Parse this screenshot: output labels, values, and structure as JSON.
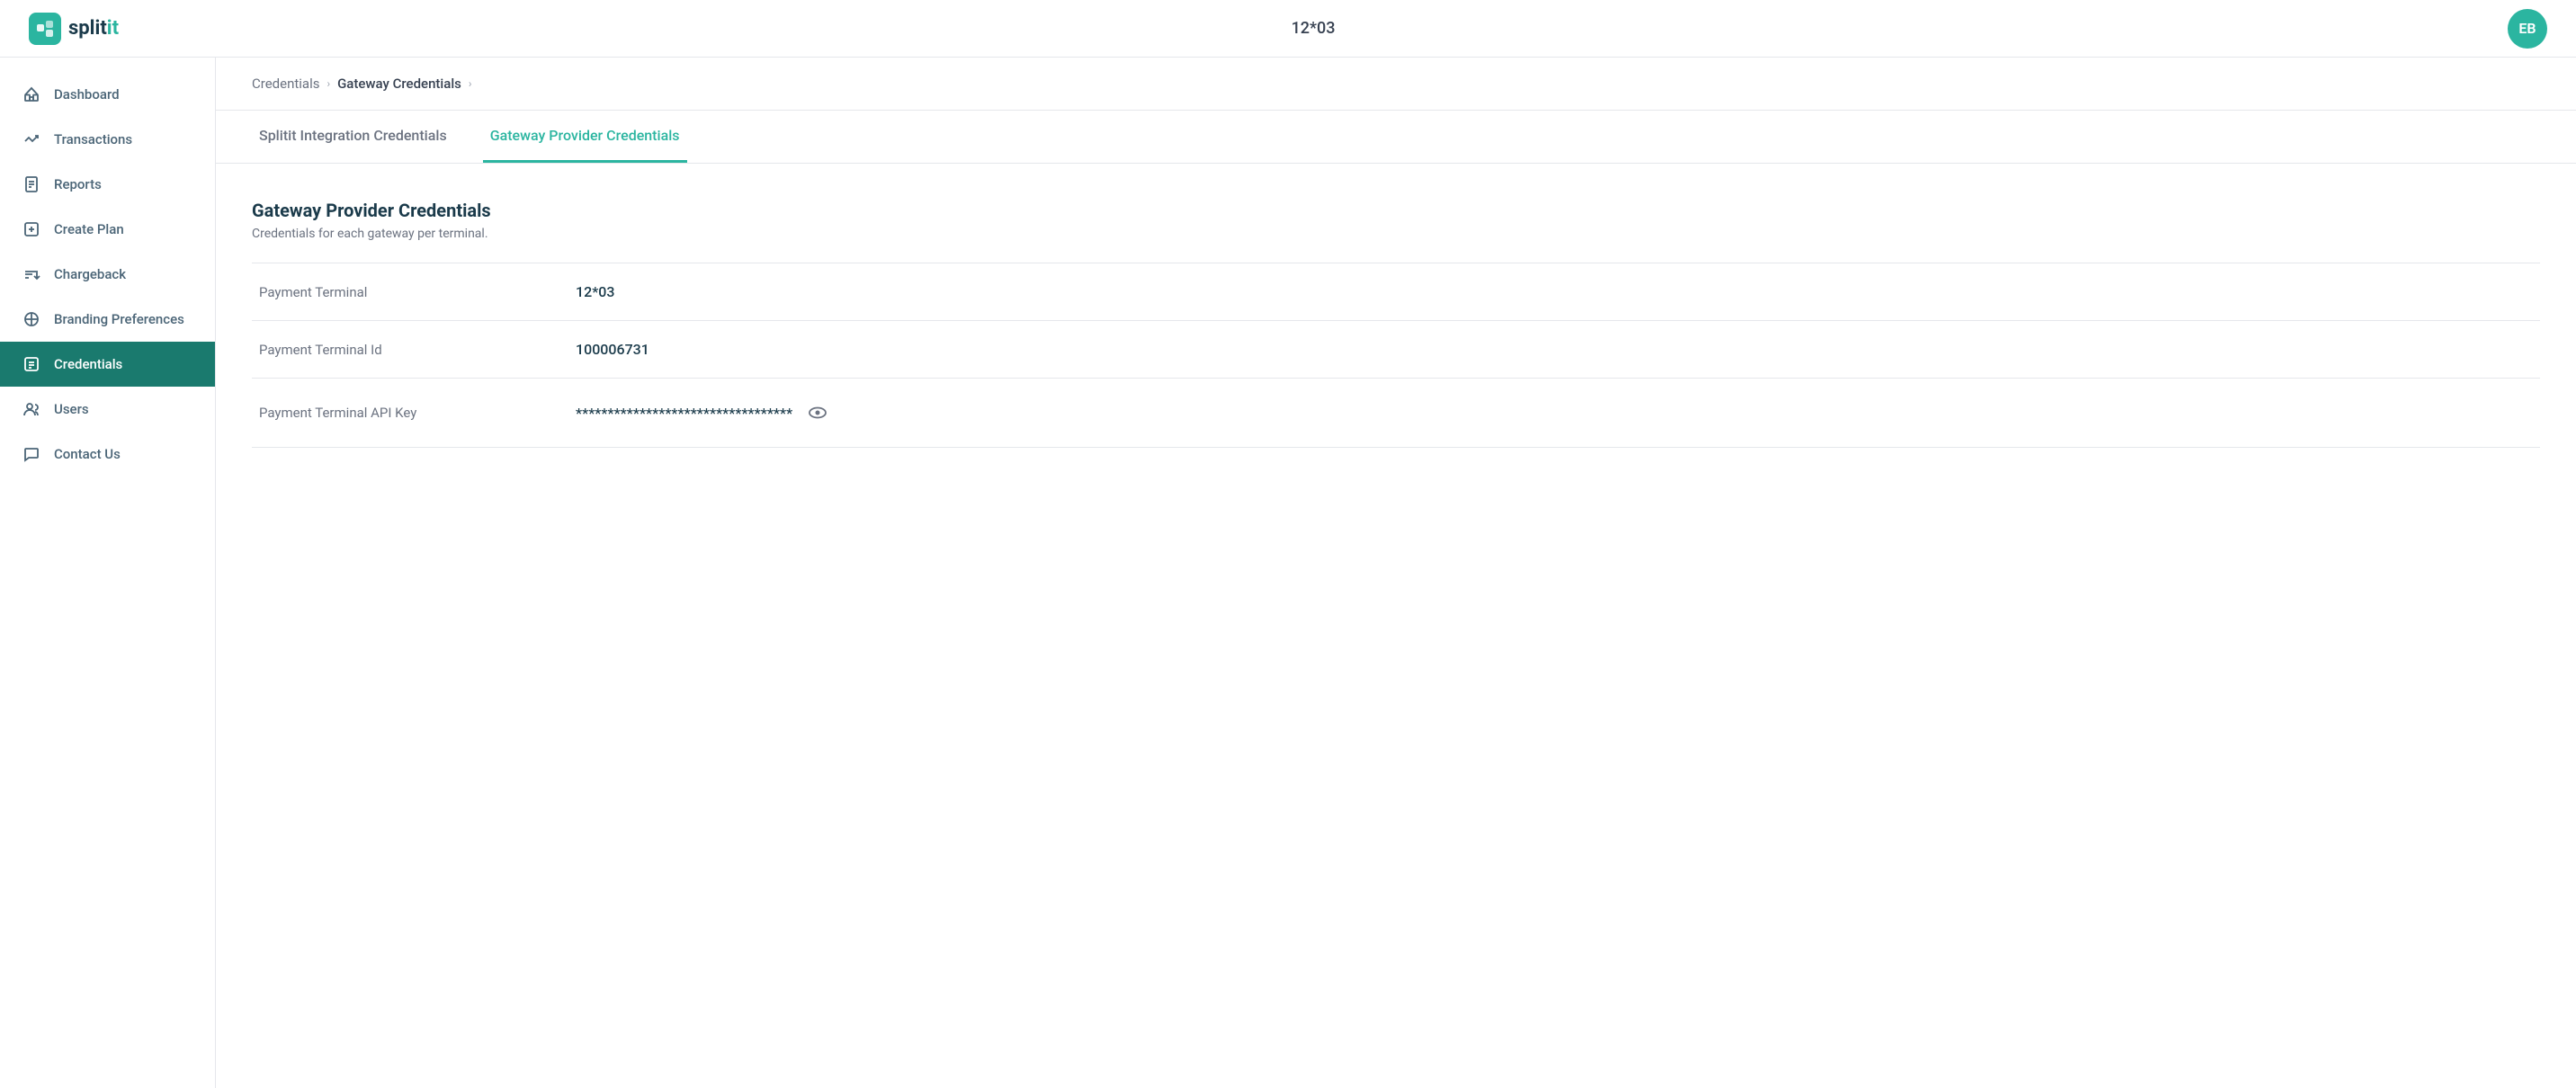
{
  "header": {
    "title": "12*03",
    "avatar_initials": "EB",
    "logo_text": "splitit"
  },
  "breadcrumb": {
    "items": [
      {
        "label": "Credentials",
        "active": false
      },
      {
        "label": "Gateway Credentials",
        "active": true
      }
    ]
  },
  "tabs": [
    {
      "label": "Splitit Integration Credentials",
      "active": false
    },
    {
      "label": "Gateway Provider Credentials",
      "active": true
    }
  ],
  "section": {
    "title": "Gateway Provider Credentials",
    "subtitle": "Credentials for each gateway per terminal."
  },
  "credentials": [
    {
      "label": "Payment Terminal",
      "value": "12*03",
      "masked": false
    },
    {
      "label": "Payment Terminal Id",
      "value": "100006731",
      "masked": false
    },
    {
      "label": "Payment Terminal API Key",
      "value": "**********************************",
      "masked": true
    }
  ],
  "sidebar": {
    "items": [
      {
        "id": "dashboard",
        "label": "Dashboard",
        "icon": "dashboard-icon"
      },
      {
        "id": "transactions",
        "label": "Transactions",
        "icon": "transactions-icon"
      },
      {
        "id": "reports",
        "label": "Reports",
        "icon": "reports-icon"
      },
      {
        "id": "create-plan",
        "label": "Create Plan",
        "icon": "create-plan-icon"
      },
      {
        "id": "chargeback",
        "label": "Chargeback",
        "icon": "chargeback-icon"
      },
      {
        "id": "branding-preferences",
        "label": "Branding Preferences",
        "icon": "branding-icon"
      },
      {
        "id": "credentials",
        "label": "Credentials",
        "icon": "credentials-icon",
        "active": true
      },
      {
        "id": "users",
        "label": "Users",
        "icon": "users-icon"
      },
      {
        "id": "contact-us",
        "label": "Contact Us",
        "icon": "contact-icon"
      }
    ]
  }
}
